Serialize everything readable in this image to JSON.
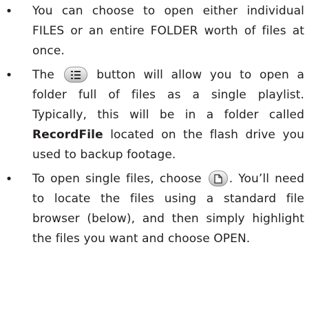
{
  "bullets": [
    {
      "symbol": "•",
      "text": "You can choose to open either individual FILES or an entire FOLDER worth of files at once."
    },
    {
      "symbol": "•",
      "part1": "The",
      "icon": "playlist-folder-icon",
      "part2": "button will allow you to open a folder full of files as a single playlist. Typically, this will be in a folder called",
      "bold": "RecordFile",
      "part3": "located on the flash drive you used to backup footage."
    },
    {
      "symbol": "•",
      "part1": "To open single files, choose",
      "icon": "open-file-icon",
      "part2": ". You’ll need to locate the files using a standard file browser (below), and then simply highlight the files you want and choose OPEN."
    }
  ]
}
